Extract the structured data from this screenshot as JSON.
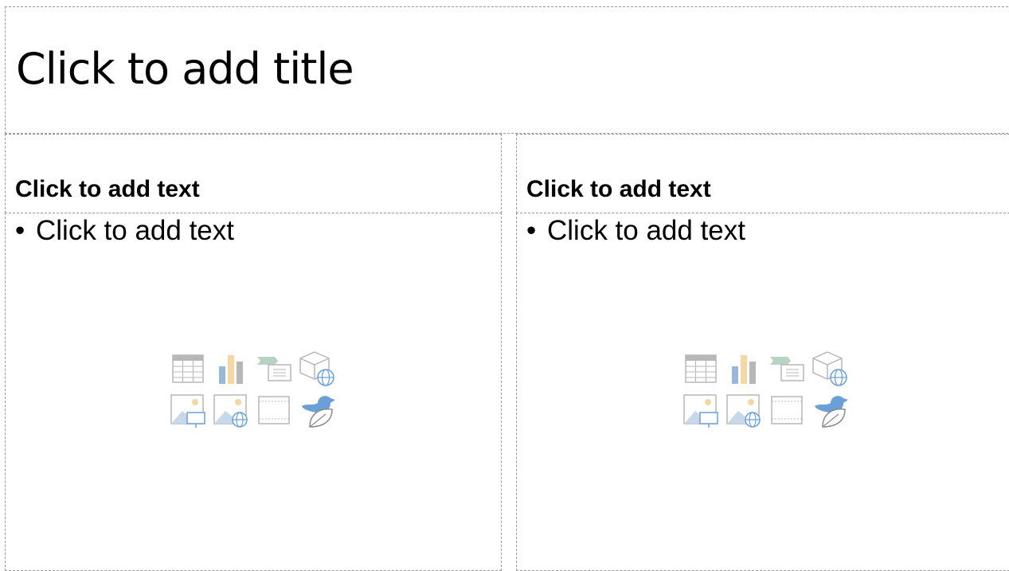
{
  "slide": {
    "title_placeholder": "Click to add title",
    "left": {
      "heading_placeholder": "Click to add text",
      "bullet_symbol": "•",
      "bullet_placeholder": "Click to add text"
    },
    "right": {
      "heading_placeholder": "Click to add text",
      "bullet_symbol": "•",
      "bullet_placeholder": "Click to add text"
    }
  },
  "insert_icons": [
    "insert-table-icon",
    "insert-chart-icon",
    "insert-smartart-icon",
    "insert-3d-model-icon",
    "insert-picture-icon",
    "insert-online-picture-icon",
    "insert-video-icon",
    "insert-icons-icon"
  ],
  "colors": {
    "placeholder_border": "#9a9a9a",
    "icon_gray": "#b7b7b7",
    "icon_blue": "#9ab9d9",
    "icon_tan": "#f3d8a6",
    "icon_green": "#b9d3c2"
  }
}
